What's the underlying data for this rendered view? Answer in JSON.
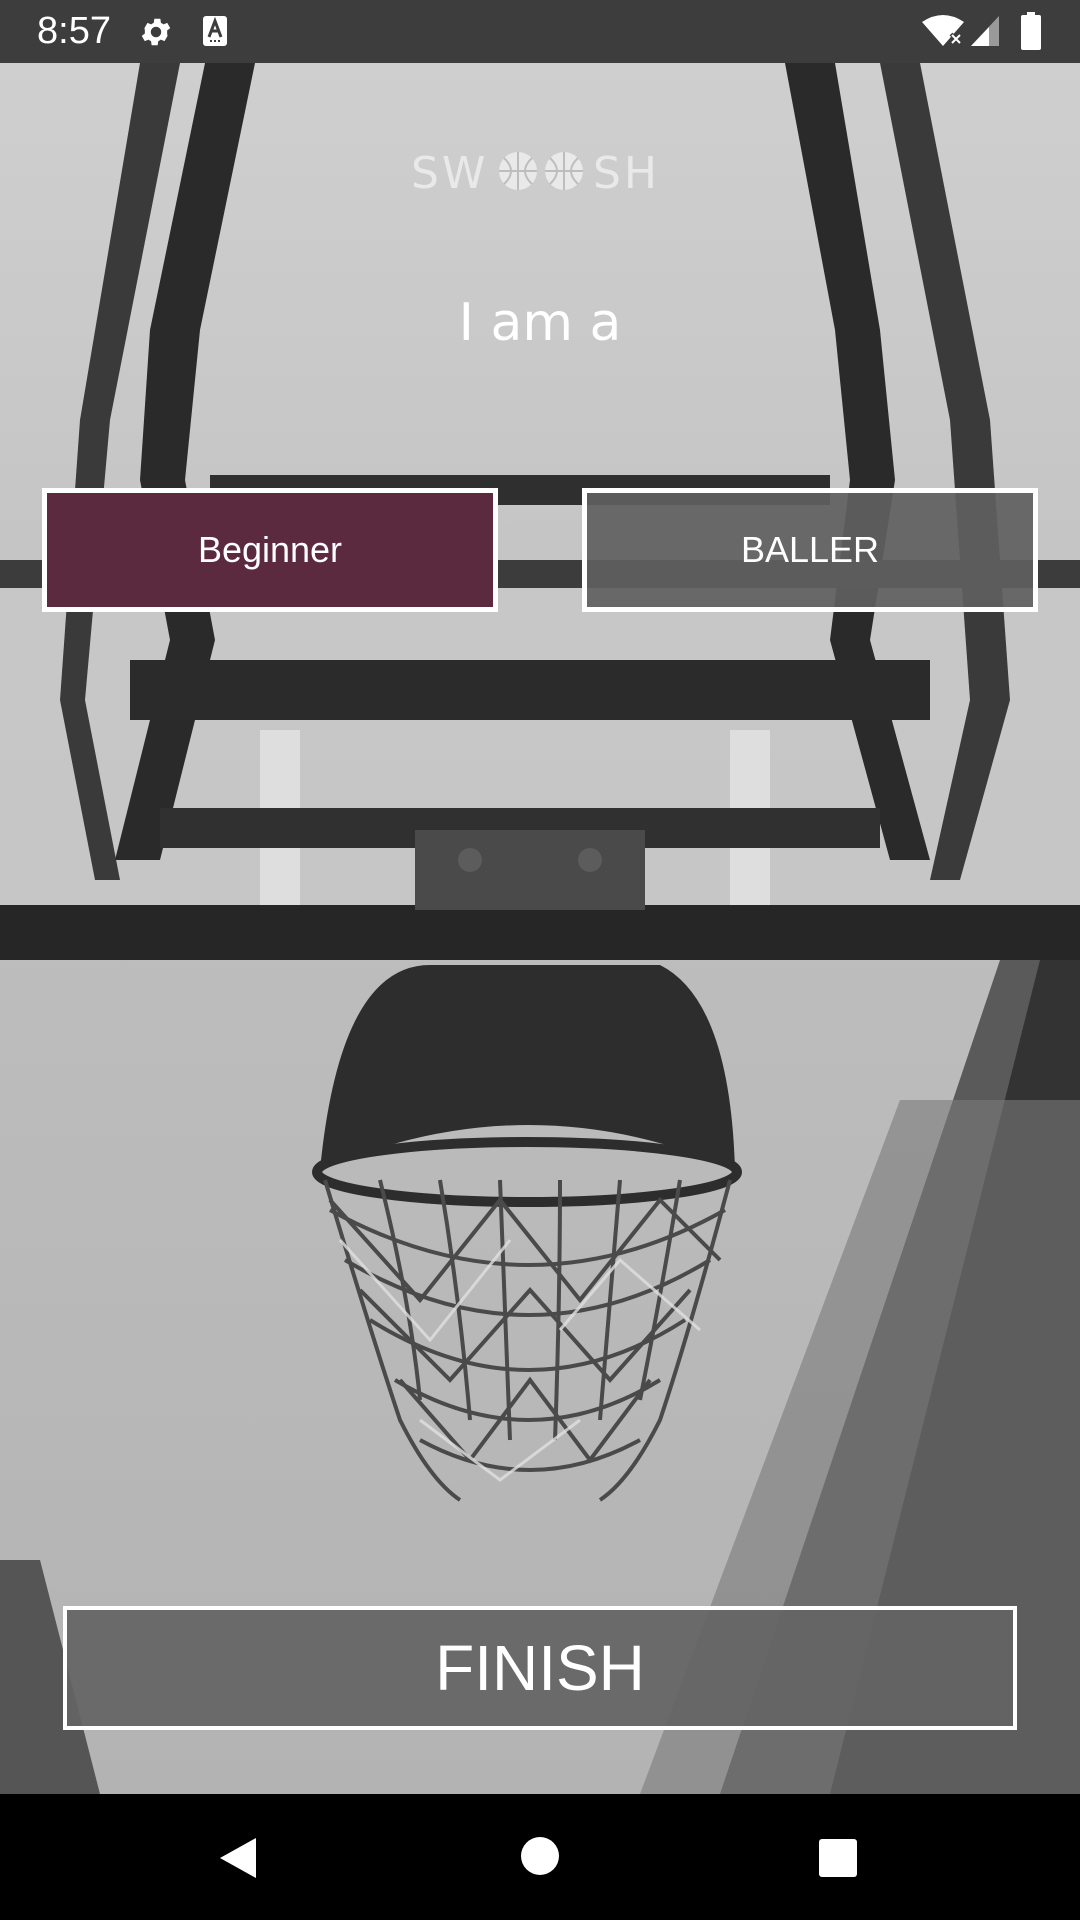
{
  "status_bar": {
    "time": "8:57",
    "icons": [
      "settings-gear-icon",
      "text-a-icon",
      "wifi-icon",
      "signal-icon",
      "battery-icon"
    ]
  },
  "logo": {
    "text_left": "SW",
    "text_right": "SH"
  },
  "heading": "I am a",
  "levels": {
    "beginner_label": "Beginner",
    "baller_label": "BALLER",
    "selected": "Beginner"
  },
  "finish_label": "FINISH",
  "colors": {
    "selected_button": "#5b2a3e",
    "unselected_button": "#5f5f5f",
    "border": "#ffffff",
    "status_bar": "#3d3d3d",
    "nav_bar": "#000000"
  },
  "nav_bar": {
    "icons": [
      "back-icon",
      "home-icon",
      "recents-icon"
    ]
  }
}
